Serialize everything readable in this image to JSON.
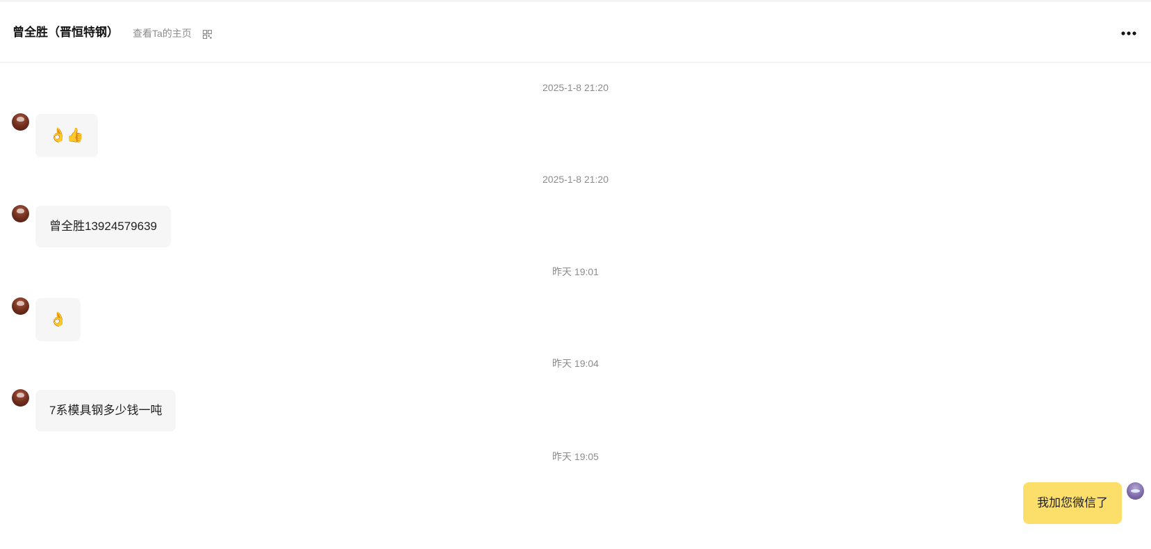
{
  "header": {
    "contact_name": "曾全胜（晋恒特钢）",
    "profile_link": "查看Ta的主页",
    "qr_icon": "qr-code-icon",
    "more_icon": "more-horizontal-icon"
  },
  "messages": [
    {
      "timestamp": "2025-1-8 21:20",
      "direction": "in",
      "kind": "emoji",
      "text": "👌👍"
    },
    {
      "timestamp": "2025-1-8 21:20",
      "direction": "in",
      "kind": "text",
      "text": "曾全胜13924579639"
    },
    {
      "timestamp": "昨天 19:01",
      "direction": "in",
      "kind": "emoji",
      "text": "👌"
    },
    {
      "timestamp": "昨天 19:04",
      "direction": "in",
      "kind": "text",
      "text": "7系模具钢多少钱一吨"
    },
    {
      "timestamp": "昨天 19:05",
      "direction": "out",
      "kind": "text",
      "text": "我加您微信了"
    }
  ],
  "colors": {
    "incoming_bubble": "#f6f6f6",
    "outgoing_bubble": "#fbdf6a",
    "timestamp_text": "#8c8c8c",
    "name_text": "#141414"
  }
}
